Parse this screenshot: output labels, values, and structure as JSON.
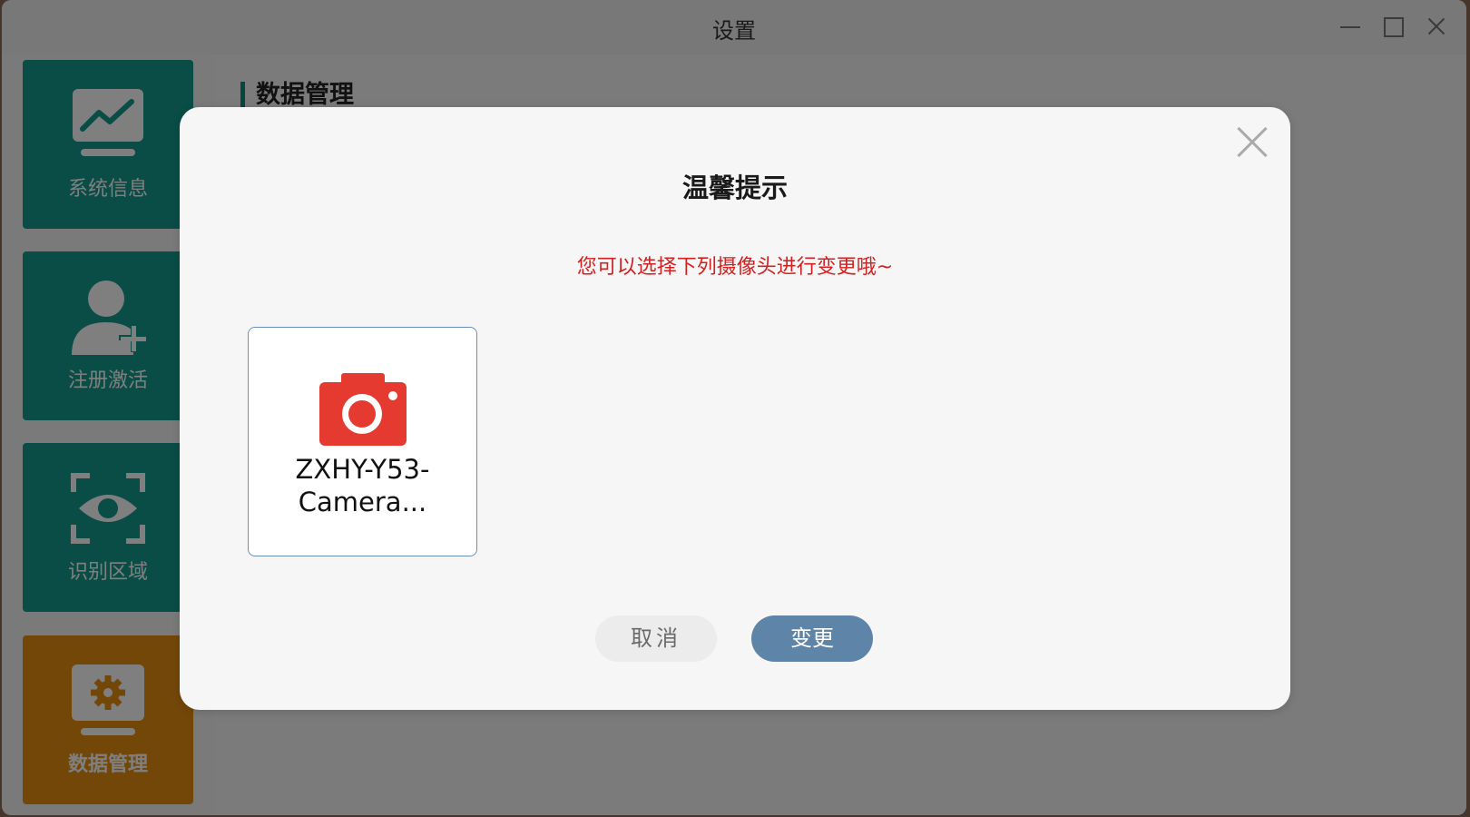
{
  "window": {
    "title": "设置"
  },
  "sidebar": {
    "items": [
      {
        "label": "系统信息",
        "icon": "chart-monitor-icon"
      },
      {
        "label": "注册激活",
        "icon": "add-user-icon"
      },
      {
        "label": "识别区域",
        "icon": "eye-scan-icon"
      },
      {
        "label": "数据管理",
        "icon": "gear-monitor-icon"
      }
    ],
    "active_index": 3
  },
  "main": {
    "section_title": "数据管理"
  },
  "dialog": {
    "title": "温馨提示",
    "message": "您可以选择下列摄像头进行变更哦~",
    "cameras": [
      {
        "name_line1": "ZXHY-Y53-",
        "name_line2": "Camera..."
      }
    ],
    "cancel_label": "取消",
    "confirm_label": "变更"
  },
  "colors": {
    "teal": "#139a8d",
    "orange": "#e68f10",
    "camera_red": "#e43a2f",
    "message_red": "#d42020",
    "confirm_blue": "#5e84a8"
  }
}
